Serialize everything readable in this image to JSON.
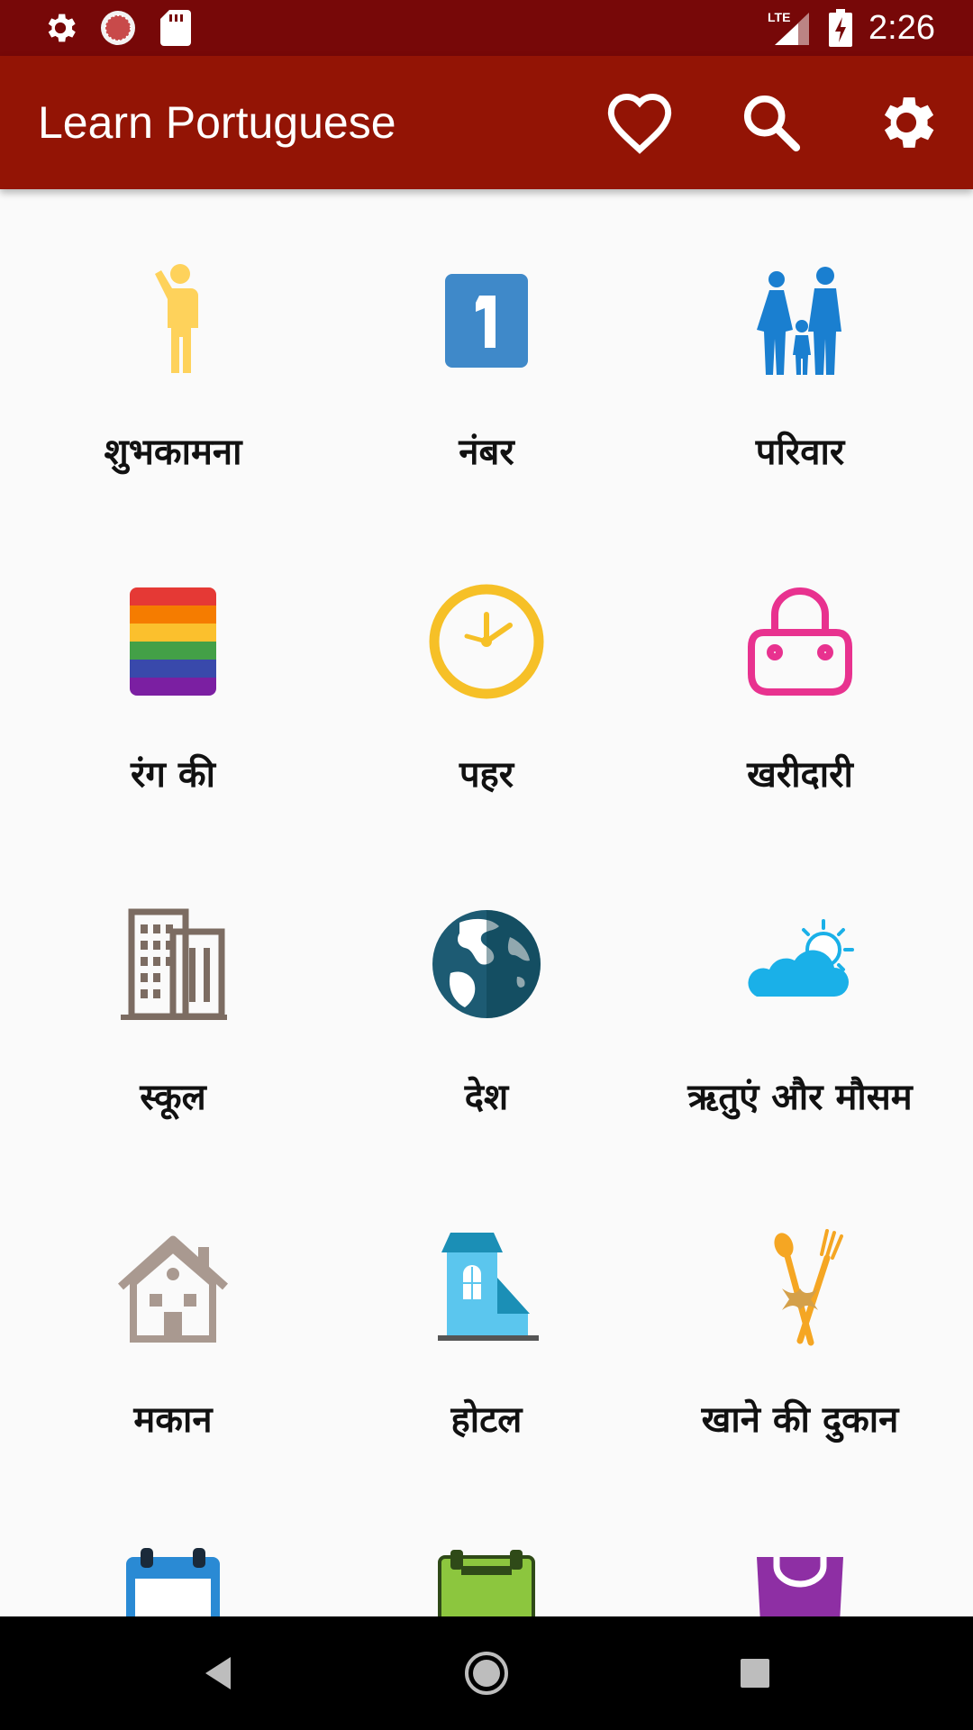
{
  "status_bar": {
    "time": "2:26",
    "network": "LTE",
    "icons": [
      "settings-icon",
      "loading-icon",
      "sd-card-icon",
      "lte-signal-icon",
      "battery-charging-icon"
    ]
  },
  "app_bar": {
    "title": "Learn Portuguese",
    "background": "#931405",
    "actions": [
      "favorite-icon",
      "search-icon",
      "settings-icon"
    ]
  },
  "categories": [
    {
      "label": "शुभकामना",
      "icon": "person-waving-icon",
      "color": "#fed25b"
    },
    {
      "label": "नंबर",
      "icon": "number-one-icon",
      "color": "#3f89c9"
    },
    {
      "label": "परिवार",
      "icon": "family-icon",
      "color": "#1a7fd0"
    },
    {
      "label": "रंग की",
      "icon": "color-stripes-icon",
      "color": "#e53935"
    },
    {
      "label": "पहर",
      "icon": "clock-icon",
      "color": "#f6c027"
    },
    {
      "label": "खरीदारी",
      "icon": "handbag-icon",
      "color": "#e8328f"
    },
    {
      "label": "स्कूल",
      "icon": "building-icon",
      "color": "#7c6c62"
    },
    {
      "label": "देश",
      "icon": "globe-icon",
      "color": "#1d5b73"
    },
    {
      "label": "ऋतुएं और मौसम",
      "icon": "cloud-sun-icon",
      "color": "#1ab0e8"
    },
    {
      "label": "मकान",
      "icon": "house-icon",
      "color": "#a99990"
    },
    {
      "label": "होटल",
      "icon": "hotel-icon",
      "color": "#5bc6ee"
    },
    {
      "label": "खाने की दुकान",
      "icon": "spoon-fork-icon",
      "color": "#f5a623"
    },
    {
      "label": "",
      "icon": "calendar-icon",
      "color": "#2a8ad4"
    },
    {
      "label": "",
      "icon": "board-icon",
      "color": "#8cc63e"
    },
    {
      "label": "",
      "icon": "bag-icon",
      "color": "#8e2fa4"
    }
  ],
  "nav_bar": {
    "buttons": [
      "back-icon",
      "home-icon",
      "recents-icon"
    ]
  }
}
